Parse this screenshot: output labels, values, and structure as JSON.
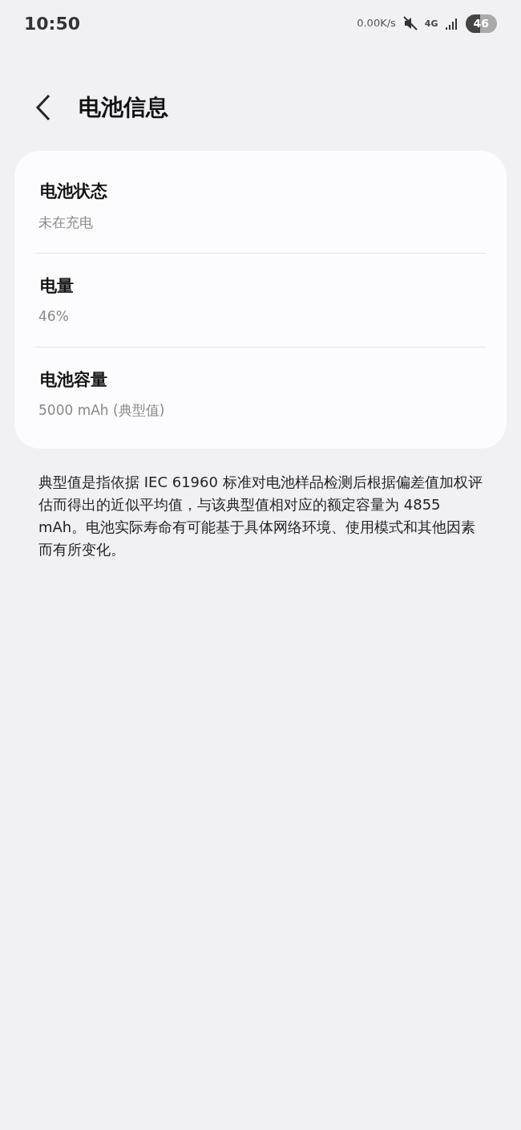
{
  "status_bar": {
    "time": "10:50",
    "net_speed": "0.00K/s",
    "network": "4G",
    "battery": "46"
  },
  "header": {
    "title": "电池信息"
  },
  "items": [
    {
      "label": "电池状态",
      "value": "未在充电"
    },
    {
      "label": "电量",
      "value": "46%"
    },
    {
      "label": "电池容量",
      "value": "5000 mAh (典型值)"
    }
  ],
  "note": "典型值是指依据 IEC 61960 标准对电池样品检测后根据偏差值加权评估而得出的近似平均值，与该典型值相对应的额定容量为 4855 mAh。电池实际寿命有可能基于具体网络环境、使用模式和其他因素而有所变化。"
}
